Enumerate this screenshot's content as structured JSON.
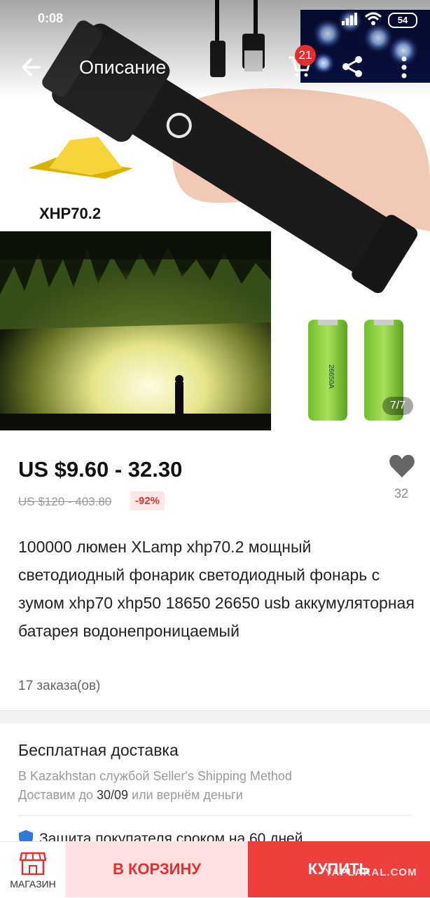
{
  "status": {
    "time": "0:08",
    "battery": "54"
  },
  "header": {
    "title": "Описание",
    "cart_count": "21"
  },
  "gallery": {
    "counter": "7/7",
    "chip_label": "XHP70.2",
    "battery_label": "26650A"
  },
  "product": {
    "price": "US $9.60 - 32.30",
    "old_price": "US $120 - 403.80",
    "discount": "-92%",
    "wishlist_count": "32",
    "description": "100000 люмен XLamp xhp70.2 мощный светодиодный фонарик светодиодный фонарь с зумом xhp70 xhp50 18650 26650 usb аккумуляторная батарея водонепроницаемый",
    "orders": "17 заказа(ов)"
  },
  "shipping": {
    "title": "Бесплатная доставка",
    "line1": "В Kazakhstan службой Seller's Shipping Method",
    "line2_prefix": "Доставим до ",
    "line2_date": "30/09",
    "line2_suffix": " или вернём деньги"
  },
  "protection": {
    "text": "Защита покупателя сроком на 60 дней"
  },
  "bottom": {
    "store_label": "МАГАЗИН",
    "add_to_cart": "В КОРЗИНУ",
    "buy": "КУПИТЬ",
    "watermark": "YAPLAKAL.COM"
  },
  "colors": {
    "accent": "#e62e2e",
    "buy_bg": "#ee3f3c",
    "cart_bg": "#fde1e1"
  }
}
